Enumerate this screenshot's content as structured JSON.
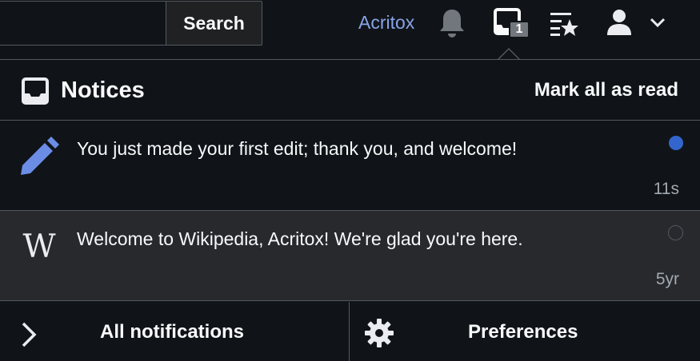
{
  "header": {
    "search_placeholder": "",
    "search_label": "Search",
    "username": "Acritox",
    "tray_count": "1"
  },
  "panel": {
    "title": "Notices",
    "mark_all_label": "Mark all as read"
  },
  "notifications": [
    {
      "icon": "pencil-icon",
      "text": "You just made your first edit; thank you, and welcome!",
      "time": "11s",
      "status": "unread"
    },
    {
      "icon": "wikipedia-logo",
      "text": "Welcome to Wikipedia, Acritox! We're glad you're here.",
      "time": "5yr",
      "status": "read"
    }
  ],
  "footer": {
    "all_label": "All notifications",
    "prefs_label": "Preferences"
  },
  "colors": {
    "background": "#101418",
    "read_row": "#27292d",
    "accent": "#3366cc",
    "link": "#88a3e8",
    "border": "#54595d"
  }
}
